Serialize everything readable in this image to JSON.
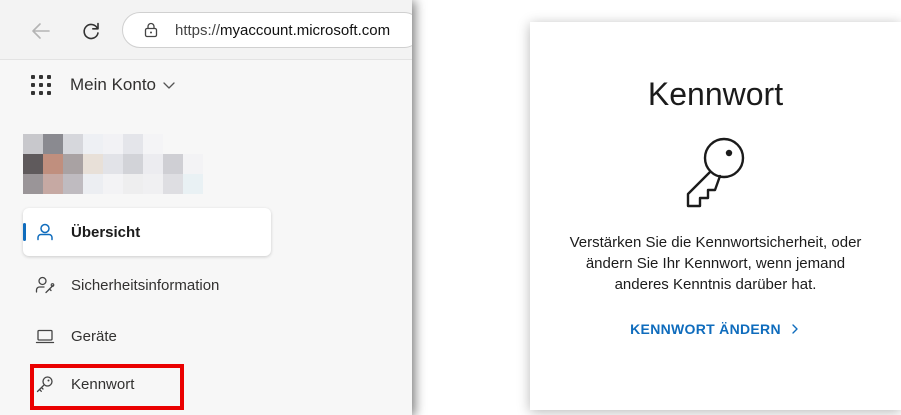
{
  "browser": {
    "url_prefix": "https://",
    "url_host": "myaccount.microsoft.com"
  },
  "header": {
    "app_title": "Mein Konto"
  },
  "sidebar": {
    "items": [
      {
        "label": "Übersicht",
        "icon": "person-icon",
        "active": true
      },
      {
        "label": "Sicherheitsinformation",
        "icon": "person-key-icon",
        "active": false
      },
      {
        "label": "Geräte",
        "icon": "laptop-icon",
        "active": false
      },
      {
        "label": "Kennwort",
        "icon": "key-icon",
        "active": false
      }
    ]
  },
  "card": {
    "title": "Kennwort",
    "icon": "key-icon",
    "description_lines": [
      "Verstärken Sie die Kennwortsicherheit, oder",
      "ändern Sie Ihr Kennwort, wenn jemand",
      "anderes Kenntnis darüber hat."
    ],
    "link_label": "KENNWORT ÄNDERN"
  },
  "colors": {
    "accent": "#0f6cbd",
    "highlight": "#ea0000"
  }
}
